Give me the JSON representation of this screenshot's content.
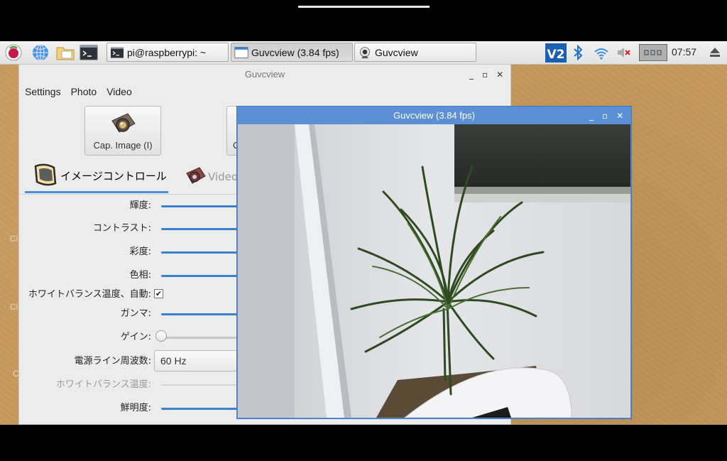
{
  "taskbar": {
    "tasks": [
      {
        "label": "pi@raspberrypi: ~",
        "icon": "terminal-icon"
      },
      {
        "label": "Guvcview  (3.84 fps)",
        "icon": "window-icon"
      },
      {
        "label": "Guvcview",
        "icon": "webcam-icon"
      }
    ],
    "clock": "07:57",
    "tray_icons": [
      "vnc-icon",
      "bluetooth-icon",
      "wifi-icon",
      "volume-muted-icon",
      "cpu-monitor-icon",
      "eject-icon"
    ]
  },
  "desktop": {
    "items": [
      "Cl",
      "Cl",
      "C"
    ]
  },
  "main_window": {
    "title": "Guvcview",
    "menu": [
      "Settings",
      "Photo",
      "Video"
    ],
    "cap_image_label": "Cap. Image (I)",
    "cap_partial_label": "C",
    "tabs": [
      {
        "label": "イメージコントロール",
        "active": true
      },
      {
        "label": "Video",
        "active": false
      }
    ],
    "controls": [
      {
        "label": "輝度:",
        "type": "slider"
      },
      {
        "label": "コントラスト:",
        "type": "slider"
      },
      {
        "label": "彩度:",
        "type": "slider"
      },
      {
        "label": "色相:",
        "type": "slider"
      },
      {
        "label": "ホワイトバランス温度、自動:",
        "type": "checkbox",
        "checked": true
      },
      {
        "label": "ガンマ:",
        "type": "slider"
      },
      {
        "label": "ゲイン:",
        "type": "slider-zero"
      },
      {
        "label": "電源ライン周波数:",
        "type": "select",
        "value": "60 Hz"
      },
      {
        "label": "ホワイトバランス温度:",
        "type": "slider-disabled"
      },
      {
        "label": "鮮明度:",
        "type": "slider"
      }
    ]
  },
  "video_window": {
    "title": "Guvcview  (3.84 fps)"
  },
  "colors": {
    "accent": "#4a90d9",
    "video_titlebar": "#5b8fd6",
    "desktop": "#c79a5d"
  }
}
